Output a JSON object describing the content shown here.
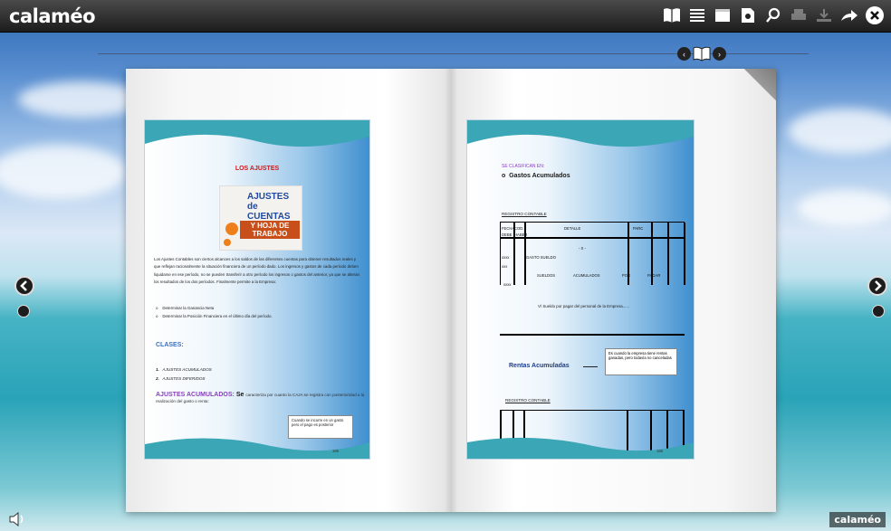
{
  "app": {
    "logo": "calaméo",
    "watermark": "calaméo"
  },
  "toolbar": {
    "icons": [
      "book-icon",
      "list-icon",
      "fullscreen-icon",
      "pdf-icon",
      "search-icon",
      "print-icon",
      "download-icon",
      "share-icon",
      "close-icon"
    ]
  },
  "left_page": {
    "title": "LOS AJUSTES",
    "cover_line1": "AJUSTES de CUENTAS",
    "cover_line2": "Y HOJA DE TRABAJO",
    "body": "Los Ajustes Contables son ciertos alcances a los saldos de las diferentes cuentas para obtener resultados reales y que reflejan racionalmente la situación financiera de un período dado. Los ingresos y gastos de cada período deben liquidarse en ese período, no se pueden transferir a otro período los ingresos o gastos del anterior, ya que se alteran los resultados de los dos períodos. Finalmente permite a la Empresa:",
    "bullets": [
      "Determinar la Ganancia Neta",
      "Determinar la Posición Financiera en el último día del período."
    ],
    "clases_title": "CLASES:",
    "clases": [
      "AJUSTES ACUMULADOS",
      "AJUSTES DIFERIDOS"
    ],
    "acum_title": "AJUSTES ACUMULADOS:",
    "acum_bold": "Se",
    "acum_text": "caracteriza por cuanto la CAJA se registra con posterioridad a la realización del gasto o renta:",
    "note": "Cuando se incurre en un gasto pero el pago es posterior",
    "page_no": "165"
  },
  "right_page": {
    "classify": "SE CLASIFICAN EN:",
    "heading": "Gastos Acumulados",
    "registro": "REGISTRO CONTABLE",
    "ledger": {
      "fecha": "FECHA",
      "cod": "COD.",
      "debe": "DEBE",
      "haber": "HABER",
      "detalle": "DETALLE",
      "parc": "PARC",
      "x": "- X -",
      "xxxx1": "xxxx",
      "xxx": "xxx",
      "xxxx2": "xxxx",
      "gasto": "GASTO SUELDO",
      "sueldos": "SUELDOS",
      "acumulados": "ACUMULADOS",
      "por": "POR",
      "pagar": "PAGAR"
    },
    "v_line": "V/ Sueldo por pagar del personal de la Empresa......",
    "rentas": "Rentas Acumuladas",
    "rentas_note": "Es cuando la empresa tiene rentas ganadas, pero todavía no canceladas",
    "registro2": "REGISTRO CONTABLE",
    "page_no": "166"
  }
}
